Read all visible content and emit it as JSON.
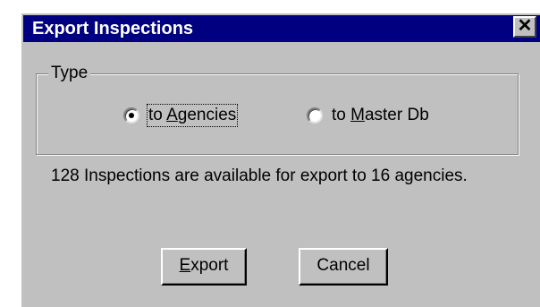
{
  "window": {
    "title": "Export Inspections",
    "close_glyph": "✕"
  },
  "type_group": {
    "legend": "Type",
    "options": [
      {
        "label_mnemonic": "A",
        "label_prefix": "to ",
        "label_rest": "gencies",
        "selected": true
      },
      {
        "label_mnemonic": "M",
        "label_prefix": "to ",
        "label_rest": "aster Db",
        "selected": false
      }
    ]
  },
  "info_text": "128 Inspections are available for export to 16 agencies.",
  "buttons": {
    "export": {
      "mnemonic": "E",
      "rest": "xport"
    },
    "cancel": {
      "label": "Cancel"
    }
  },
  "colors": {
    "titlebar": "#000080",
    "face": "#c0c0c0"
  }
}
